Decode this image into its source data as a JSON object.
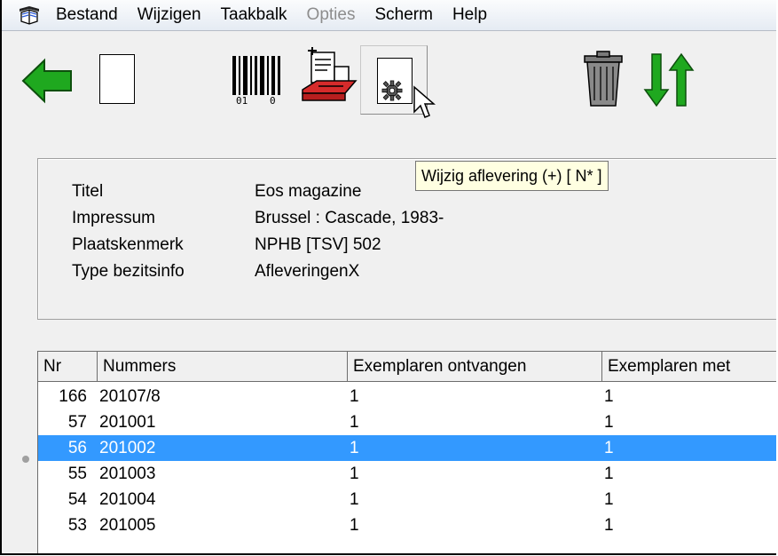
{
  "menu": {
    "items": [
      {
        "label": "Bestand",
        "enabled": true
      },
      {
        "label": "Wijzigen",
        "enabled": true
      },
      {
        "label": "Taakbalk",
        "enabled": true
      },
      {
        "label": "Opties",
        "enabled": false
      },
      {
        "label": "Scherm",
        "enabled": true
      },
      {
        "label": "Help",
        "enabled": true
      }
    ]
  },
  "toolbar": {
    "icons": [
      "back-arrow-icon",
      "new-document-icon",
      "barcode-icon",
      "print-icon",
      "edit-issue-icon",
      "trash-icon",
      "sort-icon"
    ],
    "tooltip": "Wijzig aflevering (+)  [ N* ]"
  },
  "info": {
    "rows": [
      {
        "label": "Titel",
        "value": "Eos magazine"
      },
      {
        "label": "Impressum",
        "value": "Brussel : Cascade, 1983-"
      },
      {
        "label": "Plaatskenmerk",
        "value": "NPHB [TSV] 502"
      },
      {
        "label": "Type bezitsinfo",
        "value": "AfleveringenX"
      }
    ]
  },
  "table": {
    "headers": [
      "Nr",
      "Nummers",
      "Exemplaren ontvangen",
      "Exemplaren met"
    ],
    "rows": [
      {
        "nr": "166",
        "nummer": "20107/8",
        "ontvangen": "1",
        "met": "1",
        "selected": false
      },
      {
        "nr": "57",
        "nummer": "201001",
        "ontvangen": "1",
        "met": "1",
        "selected": false
      },
      {
        "nr": "56",
        "nummer": "201002",
        "ontvangen": "1",
        "met": "1",
        "selected": true
      },
      {
        "nr": "55",
        "nummer": "201003",
        "ontvangen": "1",
        "met": "1",
        "selected": false
      },
      {
        "nr": "54",
        "nummer": "201004",
        "ontvangen": "1",
        "met": "1",
        "selected": false
      },
      {
        "nr": "53",
        "nummer": "201005",
        "ontvangen": "1",
        "met": "1",
        "selected": false
      }
    ]
  },
  "colors": {
    "selection": "#3399ff",
    "tooltip_bg": "#ffffe1",
    "arrow_green": "#1fa81f"
  }
}
